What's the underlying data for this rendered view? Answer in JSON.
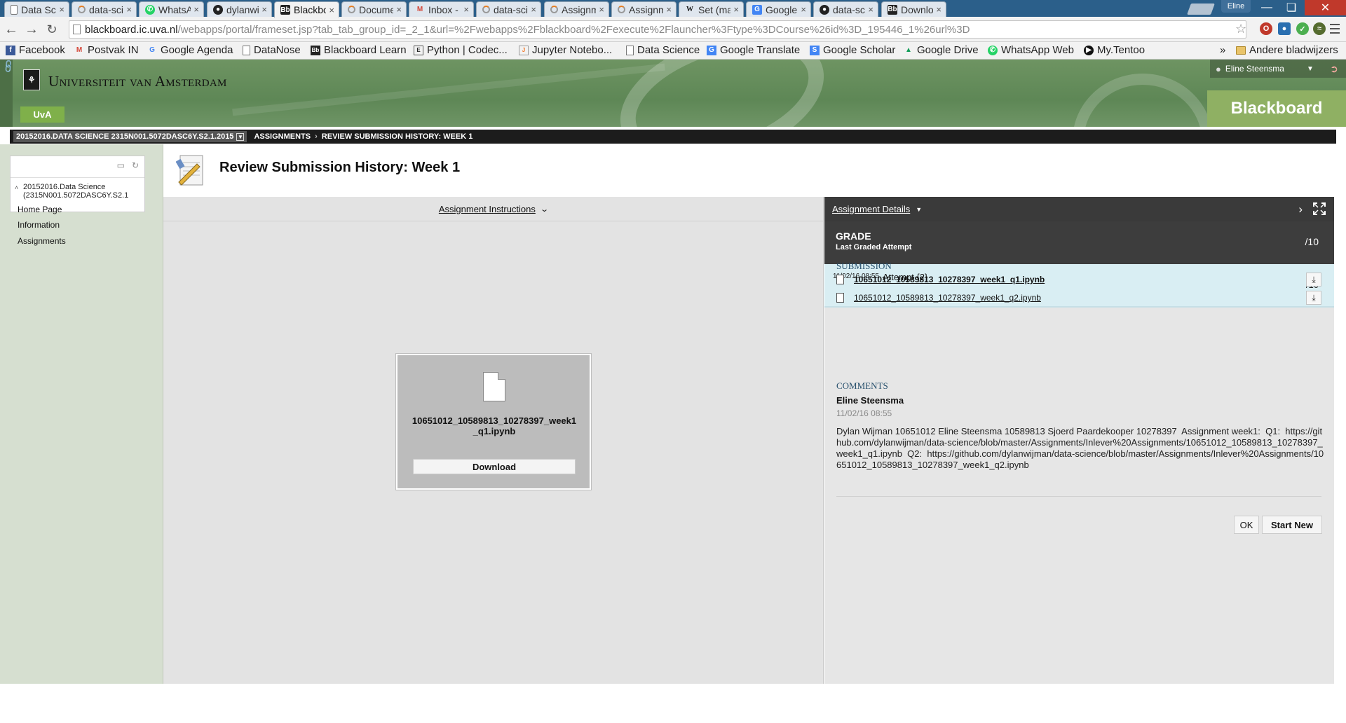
{
  "browser": {
    "tabs": [
      {
        "title": "Data Scien",
        "icon": "file",
        "active": false
      },
      {
        "title": "data-scien",
        "icon": "loading",
        "active": false
      },
      {
        "title": "WhatsApp",
        "icon": "whatsapp",
        "active": false
      },
      {
        "title": "dylanwijm",
        "icon": "github",
        "active": false
      },
      {
        "title": "Blackboar",
        "icon": "blackboard",
        "active": true
      },
      {
        "title": "Documen",
        "icon": "loading",
        "active": false
      },
      {
        "title": "Inbox - eli",
        "icon": "gmail",
        "active": false
      },
      {
        "title": "data-scien",
        "icon": "loading",
        "active": false
      },
      {
        "title": "Assignme",
        "icon": "loading",
        "active": false
      },
      {
        "title": "Assignme",
        "icon": "loading",
        "active": false
      },
      {
        "title": "Set (math",
        "icon": "wikipedia",
        "active": false
      },
      {
        "title": "Google Tr",
        "icon": "translate",
        "active": false
      },
      {
        "title": "data-scien",
        "icon": "github",
        "active": false
      },
      {
        "title": "Download",
        "icon": "blackboard",
        "active": false
      }
    ],
    "tab_close_glyph": "×",
    "profile_name": "Eline",
    "url_host": "blackboard.ic.uva.nl",
    "url_path": "/webapps/portal/frameset.jsp?tab_tab_group_id=_2_1&url=%2Fwebapps%2Fblackboard%2Fexecute%2Flauncher%3Ftype%3DCourse%26id%3D_195446_1%26url%3D",
    "bookmarks": [
      {
        "label": "Facebook",
        "icon": "facebook"
      },
      {
        "label": "Postvak IN",
        "icon": "gmail"
      },
      {
        "label": "Google Agenda",
        "icon": "google"
      },
      {
        "label": "DataNose",
        "icon": "file"
      },
      {
        "label": "Blackboard Learn",
        "icon": "blackboard"
      },
      {
        "label": "Python | Codec...",
        "icon": "python"
      },
      {
        "label": "Jupyter Notebo...",
        "icon": "jupyter"
      },
      {
        "label": "Data Science",
        "icon": "file"
      },
      {
        "label": "Google Translate",
        "icon": "translate"
      },
      {
        "label": "Google Scholar",
        "icon": "scholar"
      },
      {
        "label": "Google Drive",
        "icon": "drive"
      },
      {
        "label": "WhatsApp Web",
        "icon": "whatsapp"
      },
      {
        "label": "My.Tentoo",
        "icon": "tentoo"
      }
    ],
    "bookmarks_overflow": "»",
    "other_bookmarks": "Andere bladwijzers"
  },
  "banner": {
    "university": "Universiteit van Amsterdam",
    "badge": "UvA",
    "user_name": "Eline Steensma",
    "brand": "Blackboard"
  },
  "breadcrumb": {
    "course": "20152016.DATA SCIENCE 2315N001.5072DASC6Y.S2.1.2015",
    "items": [
      "ASSIGNMENTS",
      "REVIEW SUBMISSION HISTORY: WEEK 1"
    ],
    "separator": "›"
  },
  "course_menu": {
    "course_name": "20152016.Data Science (2315N001.5072DASC6Y.S2.1",
    "items": [
      "Home Page",
      "Information",
      "Assignments"
    ]
  },
  "page": {
    "title": "Review Submission History: Week 1"
  },
  "left_pane": {
    "instructions_label": "Assignment Instructions",
    "file_name": "10651012_10589813_10278397_week1_q1.ipynb",
    "download_label": "Download"
  },
  "right_pane": {
    "details_label": "Assignment Details",
    "grade_title": "GRADE",
    "grade_subtitle": "Last Graded Attempt",
    "grade_value": "/10",
    "attempt_date": "11/02/16 08:55",
    "attempt_label": "Attempt {2}",
    "attempt_value": "/10",
    "submission_title": "SUBMISSION",
    "files": [
      "10651012_10589813_10278397_week1_q1.ipynb",
      "10651012_10589813_10278397_week1_q2.ipynb"
    ],
    "comments_title": "COMMENTS",
    "comment_author": "Eline Steensma",
    "comment_date": "11/02/16 08:55",
    "comment_text": "Dylan Wijman 10651012 Eline Steensma 10589813 Sjoerd Paardekooper 10278397  Assignment week1:  Q1:  https://github.com/dylanwijman/data-science/blob/master/Assignments/Inlever%20Assignments/10651012_10589813_10278397_week1_q1.ipynb  Q2:  https://github.com/dylanwijman/data-science/blob/master/Assignments/Inlever%20Assignments/10651012_10589813_10278397_week1_q2.ipynb",
    "ok_label": "OK",
    "start_new_label": "Start New"
  },
  "colors": {
    "banner_green": "#6e9462",
    "brand_green": "#8fb063",
    "attempt_bg": "#d9eef3",
    "section_title": "#264f6c"
  }
}
